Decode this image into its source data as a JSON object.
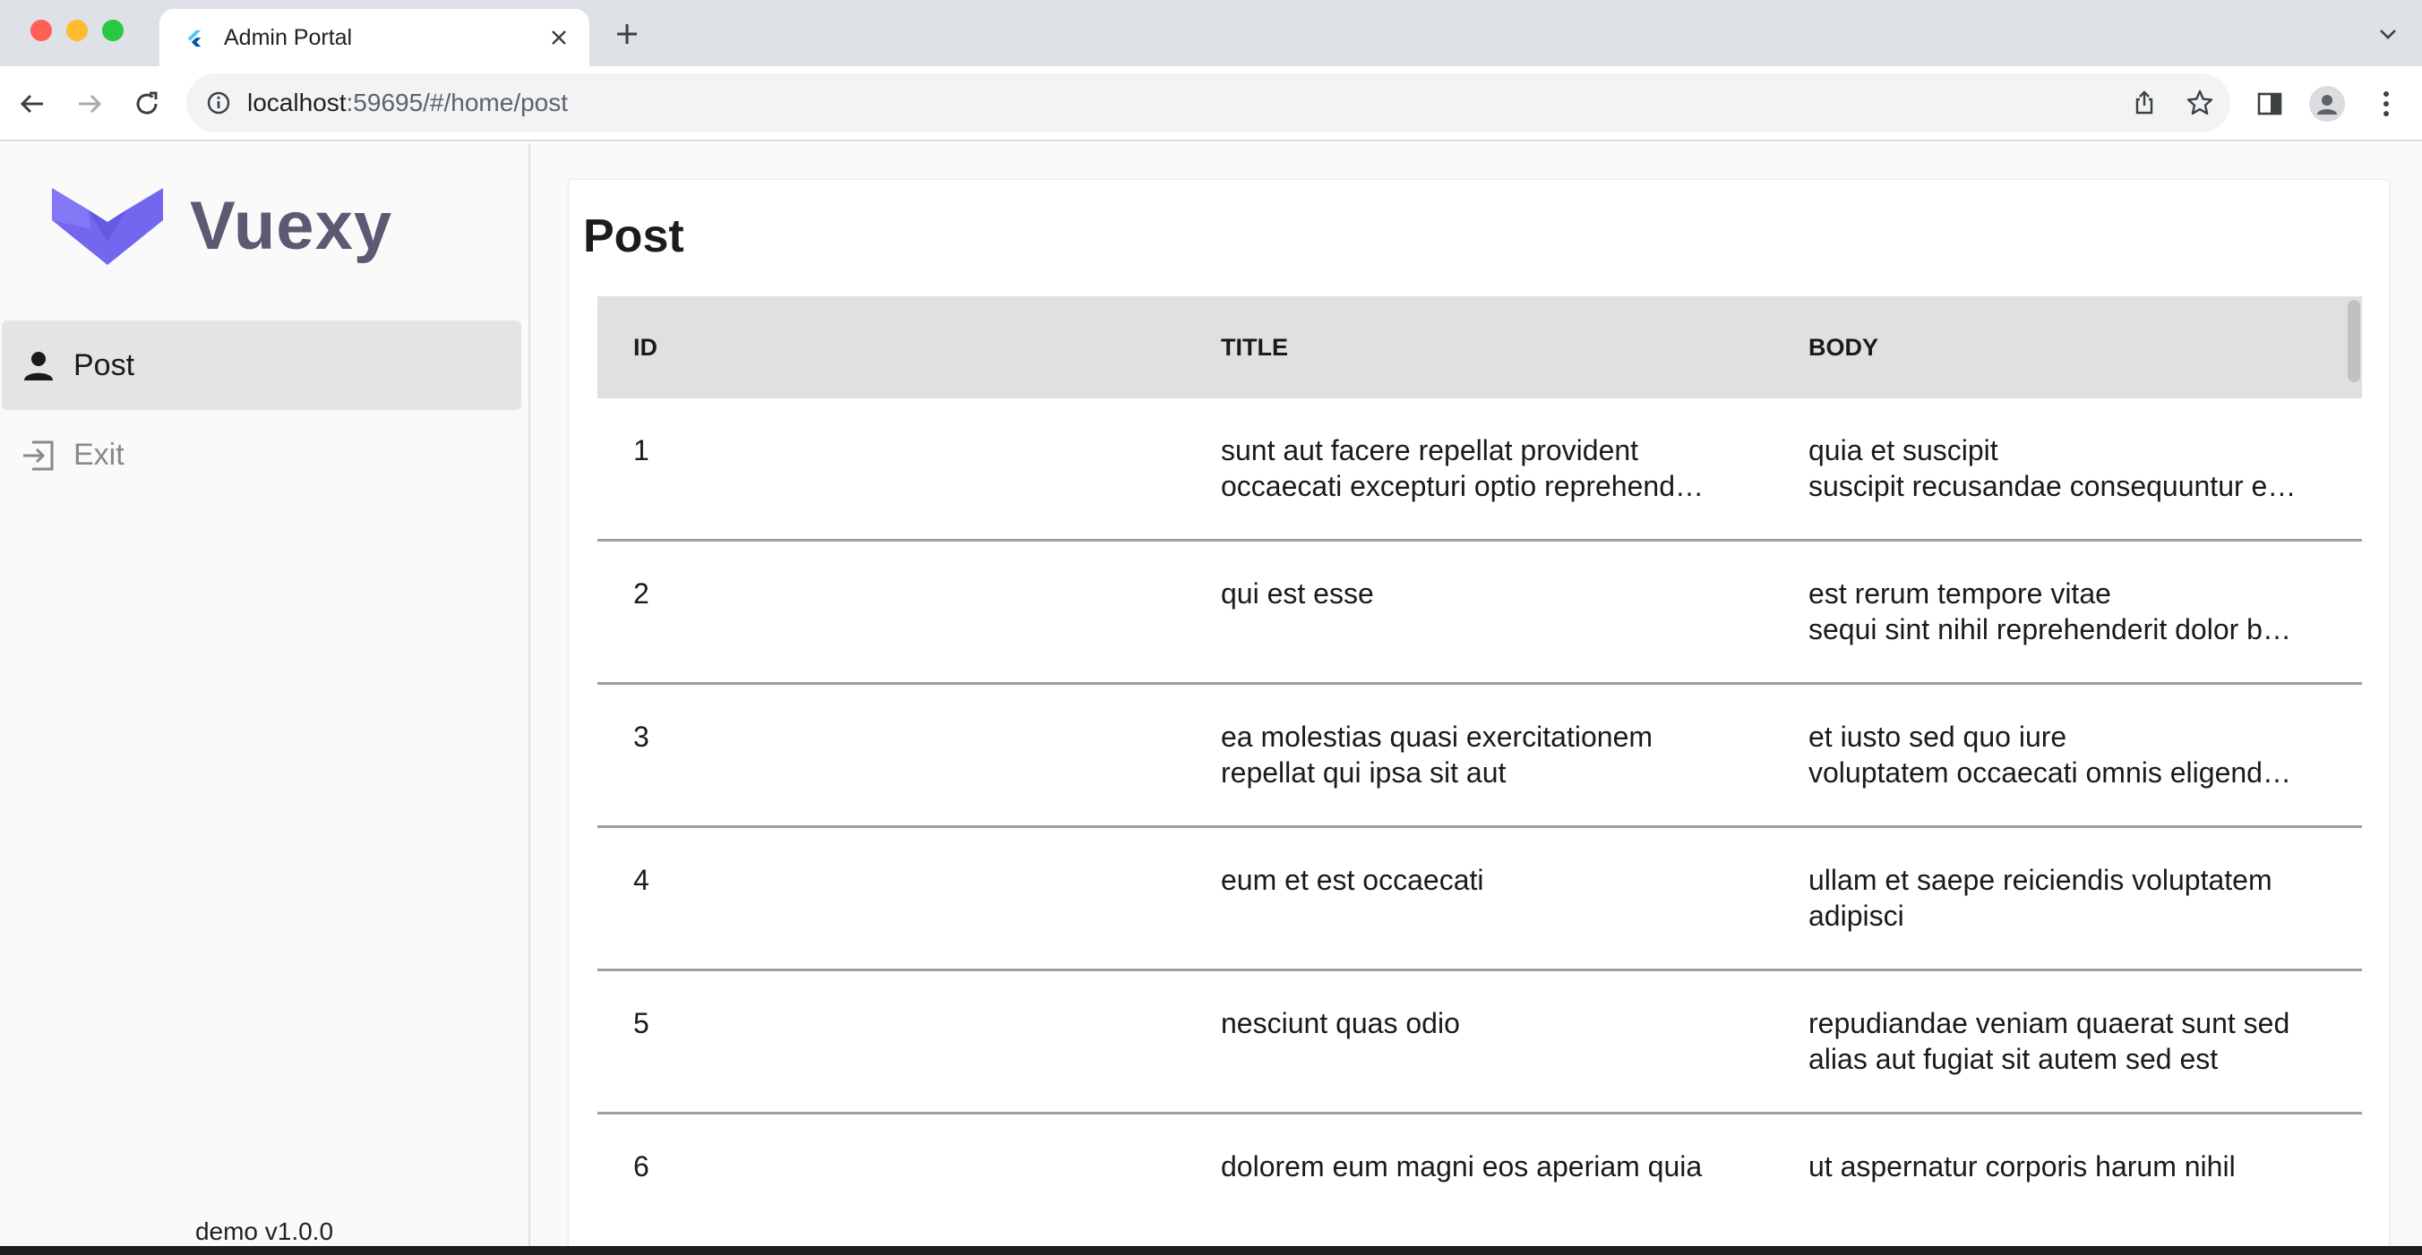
{
  "browser": {
    "tab_title": "Admin Portal",
    "url_host": "localhost",
    "url_rest": ":59695/#/home/post"
  },
  "sidebar": {
    "logo_text": "Vuexy",
    "logo_color": "#7367f0",
    "items": [
      {
        "label": "Post",
        "icon": "person-icon",
        "active": true
      },
      {
        "label": "Exit",
        "icon": "exit-icon",
        "active": false
      }
    ],
    "version": "demo v1.0.0"
  },
  "main": {
    "title": "Post",
    "table": {
      "columns": [
        "ID",
        "TITLE",
        "BODY"
      ],
      "rows": [
        {
          "id": "1",
          "title": [
            "sunt aut facere repellat provident",
            "occaecati excepturi optio reprehend…"
          ],
          "body": [
            "quia et suscipit",
            "suscipit recusandae consequuntur e…"
          ]
        },
        {
          "id": "2",
          "title": [
            "qui est esse",
            ""
          ],
          "body": [
            "est rerum tempore vitae",
            "sequi sint nihil reprehenderit dolor b…"
          ]
        },
        {
          "id": "3",
          "title": [
            "ea molestias quasi exercitationem",
            "repellat qui ipsa sit aut"
          ],
          "body": [
            "et iusto sed quo iure",
            "voluptatem occaecati omnis eligend…"
          ]
        },
        {
          "id": "4",
          "title": [
            "eum et est occaecati",
            ""
          ],
          "body": [
            "ullam et saepe reiciendis voluptatem",
            "adipisci"
          ]
        },
        {
          "id": "5",
          "title": [
            "nesciunt quas odio",
            ""
          ],
          "body": [
            "repudiandae veniam quaerat sunt sed",
            "alias aut fugiat sit autem sed est"
          ]
        },
        {
          "id": "6",
          "title": [
            "dolorem eum magni eos aperiam quia",
            ""
          ],
          "body": [
            "ut aspernatur corporis harum nihil",
            ""
          ]
        }
      ]
    }
  }
}
